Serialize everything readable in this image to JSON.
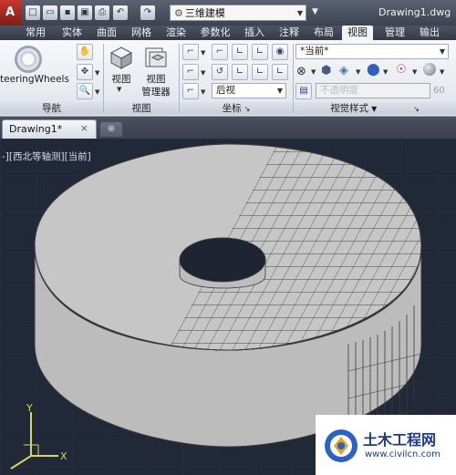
{
  "titlebar": {
    "workspace": "三维建模",
    "title": "Drawing1.dwg"
  },
  "ribbon_tabs": [
    {
      "label": "常用"
    },
    {
      "label": "实体"
    },
    {
      "label": "曲面"
    },
    {
      "label": "网格"
    },
    {
      "label": "渲染"
    },
    {
      "label": "参数化"
    },
    {
      "label": "插入"
    },
    {
      "label": "注释"
    },
    {
      "label": "布局"
    },
    {
      "label": "视图",
      "active": true
    },
    {
      "label": "管理"
    },
    {
      "label": "输出"
    }
  ],
  "panels": {
    "navigate": {
      "title": "导航",
      "steering_label": "teeringWheels"
    },
    "views": {
      "title": "视图",
      "view_label": "视图",
      "manager_label_1": "视图",
      "manager_label_2": "管理器"
    },
    "ucs": {
      "title": "坐标",
      "view_combo": "后视"
    },
    "visual_styles": {
      "title": "视觉样式",
      "style_combo": "*当前*",
      "opacity_label": "不透明度",
      "opacity_value": "60"
    }
  },
  "document": {
    "tab_name": "Drawing1*",
    "viewport_label": "-][西北等轴测][当前]"
  },
  "watermark": {
    "line1": "土木工程网",
    "line2": "www.civilcn.com"
  },
  "colors": {
    "accent_red": "#c9372c",
    "viewport_bg": "#212837",
    "model_face": "#b9b9b9",
    "watermark_blue": "#1e3a8a"
  }
}
